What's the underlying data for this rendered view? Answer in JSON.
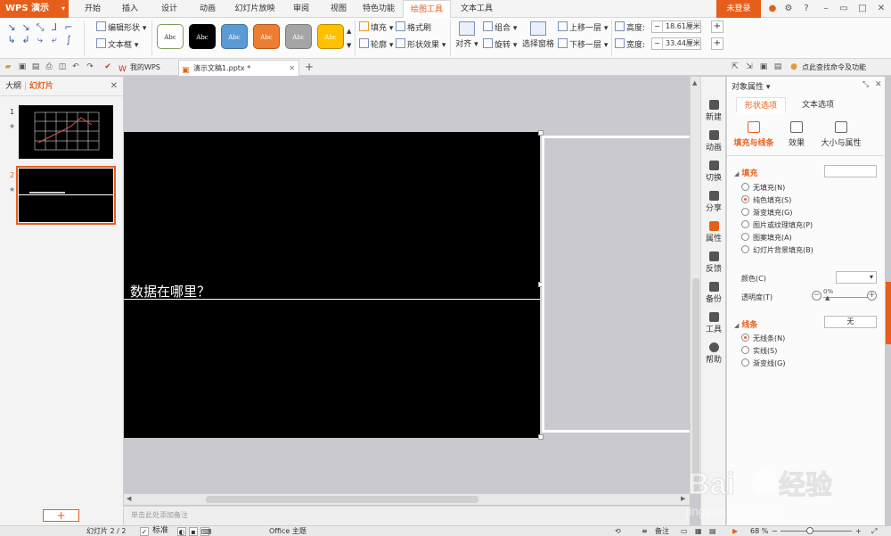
{
  "menubar": {
    "app_name": "WPS 演示",
    "tabs": [
      "开始",
      "插入",
      "设计",
      "动画",
      "幻灯片放映",
      "审阅",
      "视图",
      "特色功能",
      "绘图工具",
      "文本工具"
    ],
    "active_tab": "绘图工具",
    "login": "未登录"
  },
  "ribbon": {
    "edit_shape": "编辑形状",
    "text_box": "文本框",
    "style_label": "Abc",
    "fill": "填充",
    "format_brush": "格式刷",
    "outline": "轮廓",
    "shape_effect": "形状效果",
    "align": "对齐",
    "group": "组合",
    "rotate": "旋转",
    "selection_pane": "选择窗格",
    "bring_forward": "上移一层",
    "send_backward": "下移一层",
    "height_label": "高度:",
    "height_value": "18.61厘米",
    "width_label": "宽度:",
    "width_value": "33.44厘米"
  },
  "tabbar": {
    "tabs": [
      {
        "label": "我的WPS"
      },
      {
        "label": "演示文稿1.pptx *"
      }
    ],
    "search_hint": "点此查找命令及功能"
  },
  "leftpanel": {
    "tab_outline": "大纲",
    "tab_slides": "幻灯片",
    "slides": [
      "1",
      "2"
    ],
    "active_slide": "2"
  },
  "slide": {
    "title_text": "，数据在哪里？"
  },
  "notes_placeholder": "单击此处添加备注",
  "rail": [
    "新建",
    "动画",
    "切换",
    "分享",
    "属性",
    "反馈",
    "备份",
    "工具",
    "帮助"
  ],
  "props": {
    "header": "对象属性",
    "tabs": [
      "形状选项",
      "文本选项"
    ],
    "subtabs": [
      "填充与线条",
      "效果",
      "大小与属性"
    ],
    "fill_section": "填充",
    "fill_options": [
      "无填充(N)",
      "纯色填充(S)",
      "渐变填充(G)",
      "图片或纹理填充(P)",
      "图案填充(A)",
      "幻灯片背景填充(B)"
    ],
    "fill_selected": 1,
    "color_label": "颜色(C)",
    "transparency_label": "透明度(T)",
    "transparency_value": "0%",
    "line_section": "线条",
    "line_value": "无",
    "line_options": [
      "无线条(N)",
      "实线(S)",
      "渐变线(G)"
    ],
    "line_selected": 0
  },
  "statusbar": {
    "slide_info": "幻灯片 2 / 2",
    "standard": "标准",
    "theme": "Office 主题",
    "notes": "备注",
    "zoom": "68 %"
  },
  "colors": {
    "accent": "#e65f1a",
    "slide_bg": "#000000"
  }
}
